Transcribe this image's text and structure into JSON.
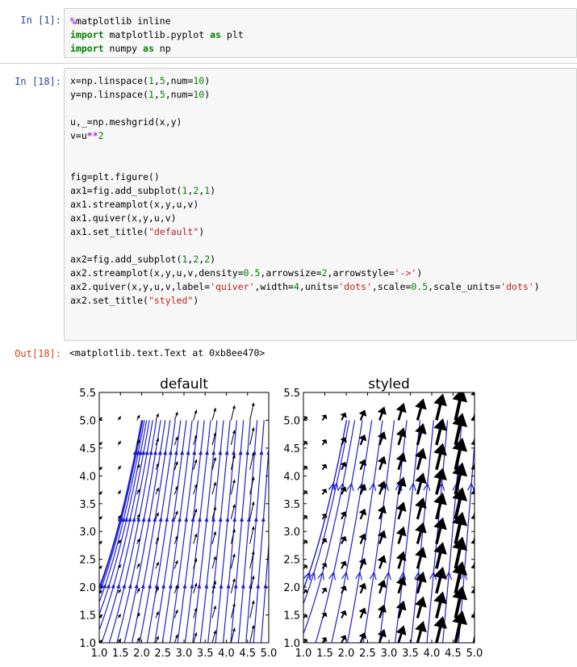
{
  "cell1": {
    "prompt": "In  [1]:",
    "lines": [
      [
        [
          "mg",
          "%"
        ],
        [
          "",
          "matplotlib inline"
        ]
      ],
      [
        [
          "kw",
          "import"
        ],
        [
          "",
          " matplotlib.pyplot "
        ],
        [
          "kw",
          "as"
        ],
        [
          "",
          " plt"
        ]
      ],
      [
        [
          "kw",
          "import"
        ],
        [
          "",
          " numpy "
        ],
        [
          "kw",
          "as"
        ],
        [
          "",
          " np"
        ]
      ]
    ]
  },
  "cell2": {
    "prompt": "In  [18]:",
    "lines": [
      [
        [
          "",
          "x=np.linspace("
        ],
        [
          "num",
          "1"
        ],
        [
          "",
          ","
        ],
        [
          "num",
          "5"
        ],
        [
          "",
          ",num="
        ],
        [
          "num",
          "10"
        ],
        [
          "",
          ")"
        ]
      ],
      [
        [
          "",
          "y=np.linspace("
        ],
        [
          "num",
          "1"
        ],
        [
          "",
          ","
        ],
        [
          "num",
          "5"
        ],
        [
          "",
          ",num="
        ],
        [
          "num",
          "10"
        ],
        [
          "",
          ")"
        ]
      ],
      [
        [
          "",
          ""
        ]
      ],
      [
        [
          "",
          "u,_=np.meshgrid(x,y)"
        ]
      ],
      [
        [
          "",
          "v=u"
        ],
        [
          "mg",
          "**"
        ],
        [
          "num",
          "2"
        ]
      ],
      [
        [
          "",
          ""
        ]
      ],
      [
        [
          "",
          ""
        ]
      ],
      [
        [
          "",
          "fig=plt.figure()"
        ]
      ],
      [
        [
          "",
          "ax1=fig.add_subplot("
        ],
        [
          "num",
          "1"
        ],
        [
          "",
          ","
        ],
        [
          "num",
          "2"
        ],
        [
          "",
          ","
        ],
        [
          "num",
          "1"
        ],
        [
          "",
          ")"
        ]
      ],
      [
        [
          "",
          "ax1.streamplot(x,y,u,v)"
        ]
      ],
      [
        [
          "",
          "ax1.quiver(x,y,u,v)"
        ]
      ],
      [
        [
          "",
          "ax1.set_title("
        ],
        [
          "str",
          "\"default\""
        ],
        [
          "",
          ")"
        ]
      ],
      [
        [
          "",
          ""
        ]
      ],
      [
        [
          "",
          "ax2=fig.add_subplot("
        ],
        [
          "num",
          "1"
        ],
        [
          "",
          ","
        ],
        [
          "num",
          "2"
        ],
        [
          "",
          ","
        ],
        [
          "num",
          "2"
        ],
        [
          "",
          ")"
        ]
      ],
      [
        [
          "",
          "ax2.streamplot(x,y,u,v,density="
        ],
        [
          "num",
          "0.5"
        ],
        [
          "",
          ",arrowsize="
        ],
        [
          "num",
          "2"
        ],
        [
          "",
          ",arrowstyle="
        ],
        [
          "str",
          "'->'"
        ],
        [
          "",
          ")"
        ]
      ],
      [
        [
          "",
          "ax2.quiver(x,y,u,v,label="
        ],
        [
          "str",
          "'quiver'"
        ],
        [
          "",
          ",width="
        ],
        [
          "num",
          "4"
        ],
        [
          "",
          ",units="
        ],
        [
          "str",
          "'dots'"
        ],
        [
          "",
          ",scale="
        ],
        [
          "num",
          "0.5"
        ],
        [
          "",
          ",scale_units="
        ],
        [
          "str",
          "'dots'"
        ],
        [
          "",
          ")"
        ]
      ],
      [
        [
          "",
          "ax2.set_title("
        ],
        [
          "str",
          "\"styled\""
        ],
        [
          "",
          ")"
        ]
      ]
    ]
  },
  "output": {
    "prompt": "Out[18]:",
    "text": "<matplotlib.text.Text at 0xb8ee470>"
  },
  "colors": {
    "stream": "#1f1fcf",
    "quiver": "#000000",
    "prompt_in": "#303f9f",
    "prompt_out": "#d84315"
  },
  "chart_data": [
    {
      "type": "vector-field",
      "title": "default",
      "xlim": [
        1.0,
        5.0
      ],
      "ylim": [
        1.0,
        5.5
      ],
      "xticks": [
        "1.0",
        "1.5",
        "2.0",
        "2.5",
        "3.0",
        "3.5",
        "4.0",
        "4.5",
        "5.0"
      ],
      "yticks": [
        "1.0",
        "1.5",
        "2.0",
        "2.5",
        "3.0",
        "3.5",
        "4.0",
        "4.5",
        "5.0",
        "5.5"
      ],
      "grid": [
        1.0,
        1.444,
        1.889,
        2.333,
        2.778,
        3.222,
        3.667,
        4.111,
        4.556,
        5.0
      ],
      "field": "u = x, v = x^2",
      "stream_density": 1.0
    },
    {
      "type": "vector-field",
      "title": "styled",
      "xlim": [
        1.0,
        5.0
      ],
      "ylim": [
        1.0,
        5.5
      ],
      "xticks": [
        "1.0",
        "1.5",
        "2.0",
        "2.5",
        "3.0",
        "3.5",
        "4.0",
        "4.5",
        "5.0"
      ],
      "yticks": [
        "1.0",
        "1.5",
        "2.0",
        "2.5",
        "3.0",
        "3.5",
        "4.0",
        "4.5",
        "5.0",
        "5.5"
      ],
      "grid": [
        1.0,
        1.444,
        1.889,
        2.333,
        2.778,
        3.222,
        3.667,
        4.111,
        4.556,
        5.0
      ],
      "field": "u = x, v = x^2",
      "stream_density": 0.5
    }
  ]
}
